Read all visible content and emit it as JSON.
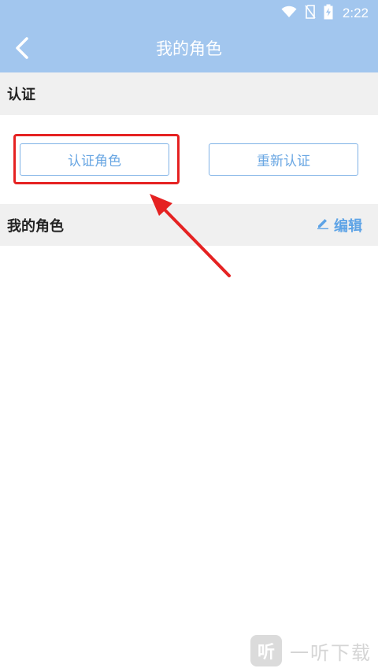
{
  "status_bar": {
    "time": "2:22",
    "icons": [
      "wifi-icon",
      "no-sim-icon",
      "battery-charging-icon"
    ]
  },
  "app_bar": {
    "back_icon": "chevron-left-icon",
    "title": "我的角色"
  },
  "auth_section": {
    "title": "认证",
    "buttons": {
      "authenticate_role": "认证角色",
      "reauthenticate": "重新认证"
    }
  },
  "roles_section": {
    "title": "我的角色",
    "edit_icon": "pencil-icon",
    "edit_label": "编辑"
  },
  "annotations": {
    "highlight_color": "#e52222"
  },
  "watermark": {
    "logo": "听",
    "text": "一听下载"
  },
  "colors": {
    "app_bar": "#a2c6ee",
    "accent": "#5da3e6",
    "section_bg": "#f0f0f0"
  }
}
